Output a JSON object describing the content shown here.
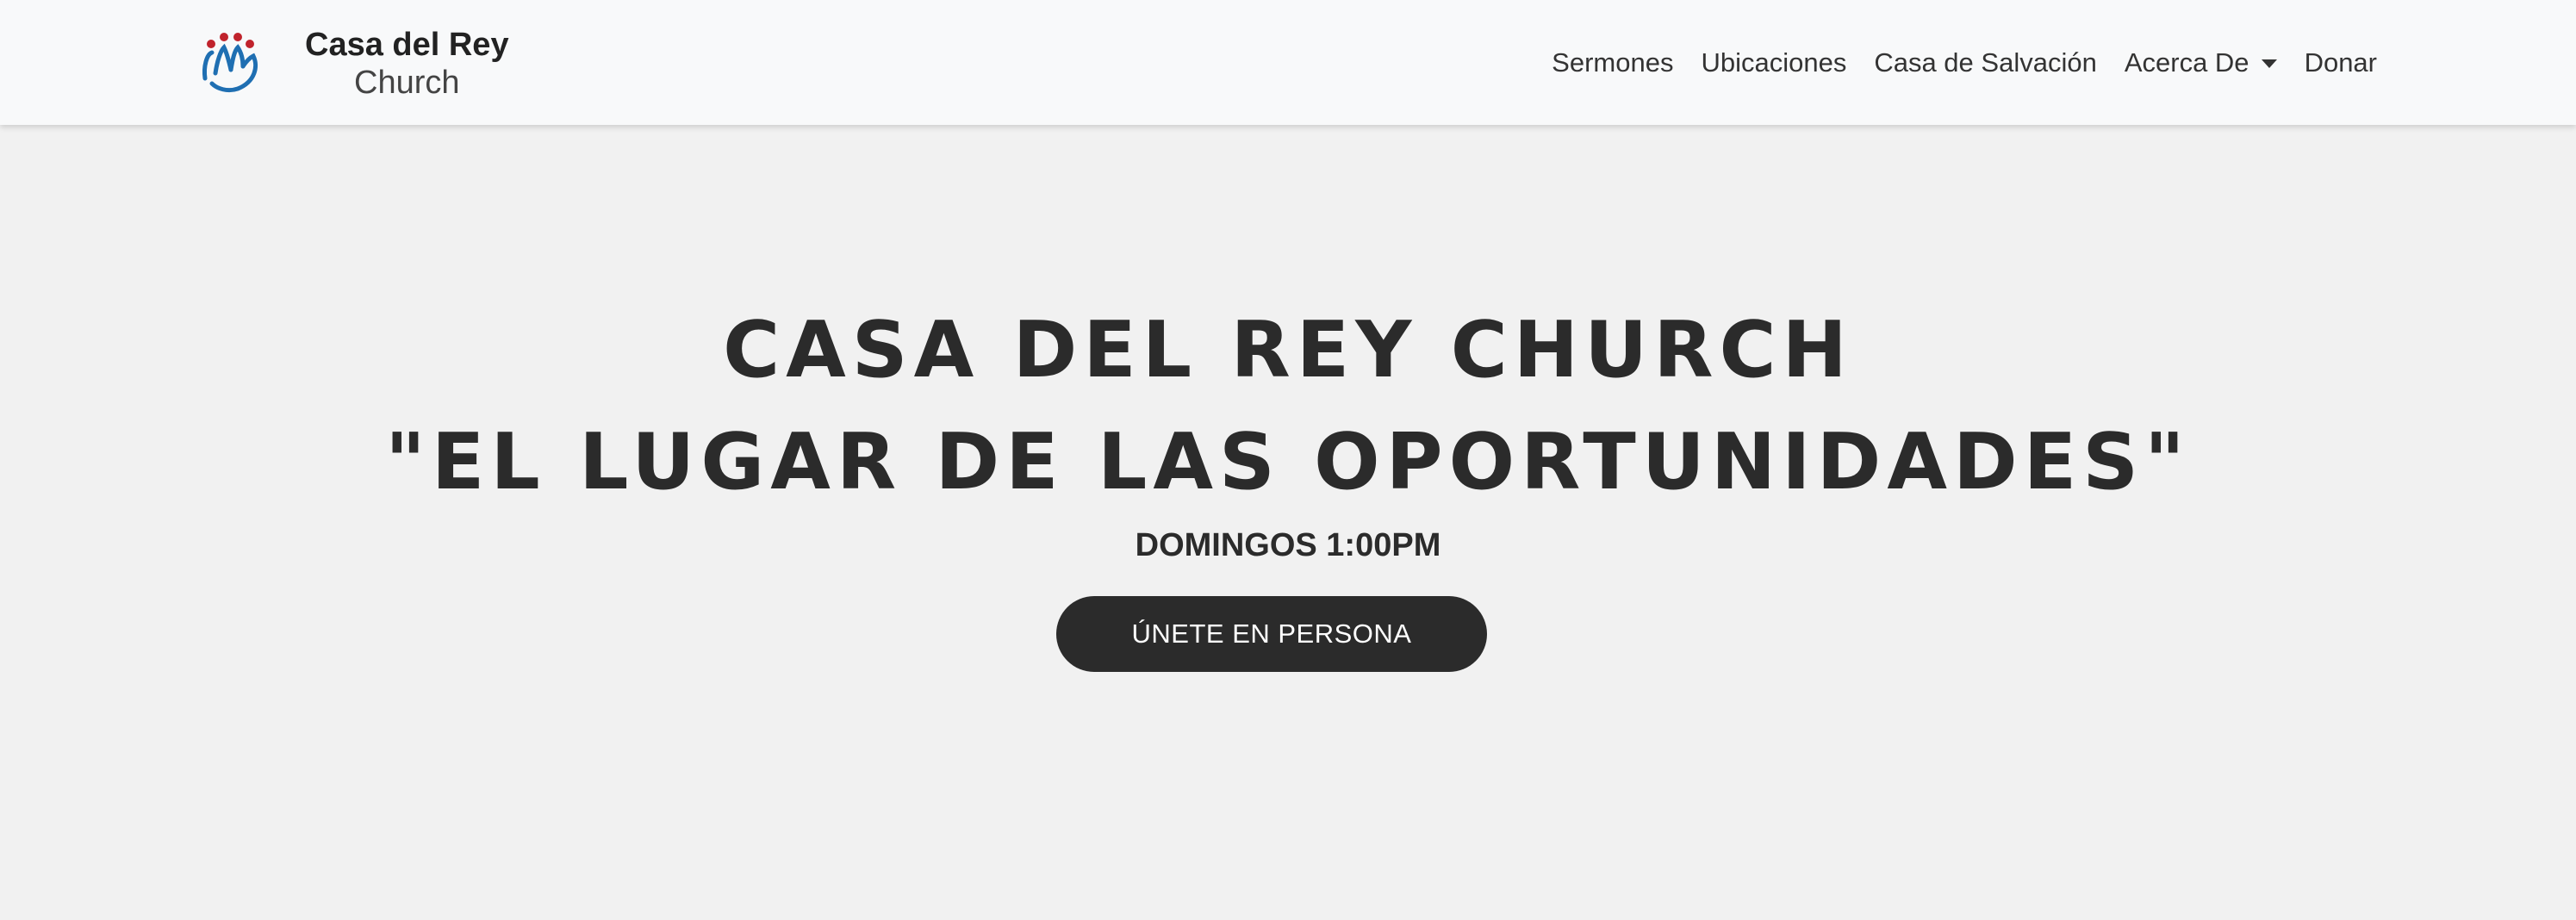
{
  "brand": {
    "line1": "Casa del Rey",
    "line2": "Church",
    "logo_icon": "church-people-logo-icon"
  },
  "nav": {
    "items": [
      {
        "label": "Sermones"
      },
      {
        "label": "Ubicaciones"
      },
      {
        "label": "Casa de Salvación"
      },
      {
        "label": "Acerca De",
        "has_dropdown": true
      },
      {
        "label": "Donar"
      }
    ]
  },
  "hero": {
    "title_line1": "CASA DEL REY CHURCH",
    "title_line2": "\"EL LUGAR DE LAS OPORTUNIDADES\"",
    "subtitle": "DOMINGOS 1:00PM",
    "cta_label": "ÚNETE EN PERSONA"
  },
  "colors": {
    "page_background": "#f1f1f1",
    "navbar_background": "#f8f9fa",
    "text_dark": "#2b2b2b",
    "button_background": "#2b2b2b",
    "button_text": "#ffffff",
    "logo_red": "#c0232c",
    "logo_blue": "#1f6fb2"
  }
}
